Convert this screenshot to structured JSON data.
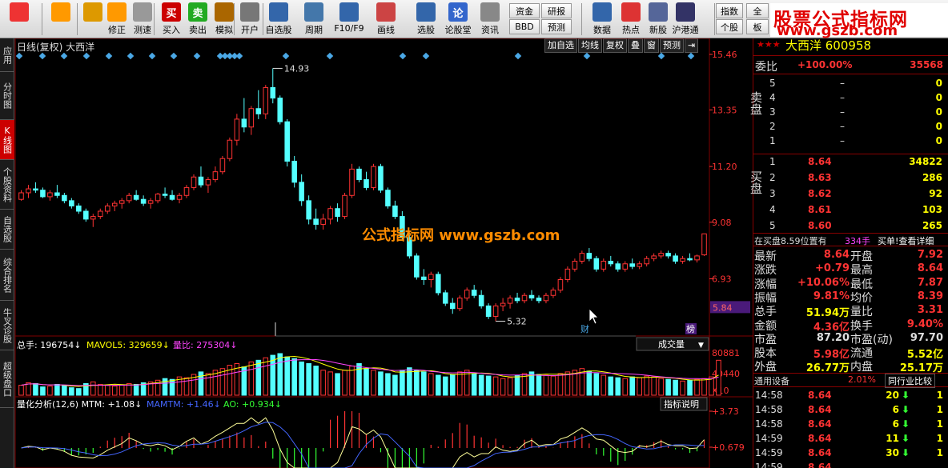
{
  "toolbar": {
    "buttons": [
      {
        "label": "",
        "icon": "grid-icon"
      },
      {
        "label": "",
        "icon": "back-arrow-icon"
      },
      {
        "label": "",
        "icon": "up-down-arrow-icon"
      },
      {
        "label": "修正",
        "icon": "correct-icon"
      },
      {
        "label": "测速",
        "icon": "clock-icon"
      },
      {
        "label": "买入",
        "icon": "buy-icon",
        "glyph": "买"
      },
      {
        "label": "卖出",
        "icon": "sell-icon",
        "glyph": "卖"
      },
      {
        "label": "模拟",
        "icon": "hammer-icon"
      },
      {
        "label": "开户",
        "icon": "lock-icon"
      },
      {
        "label": "自选股",
        "icon": "star-folder-icon"
      },
      {
        "label": "周期",
        "icon": "clock-cycle-icon"
      },
      {
        "label": "F10/F9",
        "icon": "f10-icon"
      },
      {
        "label": "画线",
        "icon": "pen-icon"
      },
      {
        "label": "选股",
        "icon": "select-stock-icon"
      },
      {
        "label": "论股堂",
        "icon": "forum-icon",
        "glyph": "论"
      },
      {
        "label": "资讯",
        "icon": "news-icon"
      },
      {
        "label": "数据",
        "icon": "data-icon"
      },
      {
        "label": "热点",
        "icon": "hot-icon"
      },
      {
        "label": "新股",
        "icon": "ipo-icon"
      },
      {
        "label": "沪港通",
        "icon": "hk-connect-icon"
      }
    ],
    "pills": [
      "资金",
      "BBD",
      "研报",
      "预测",
      "指数",
      "个股"
    ],
    "pill_partial": [
      "全",
      "板"
    ]
  },
  "logo": {
    "line1": "股票公式指标网",
    "line2": "www.gszb.com"
  },
  "sidebar": {
    "tabs": [
      "应用",
      "分时图",
      "K线图",
      "个股资料",
      "自选股",
      "综合排名",
      "牛叉诊股",
      "超级盘口"
    ],
    "active": 2
  },
  "chart": {
    "title": "日线(复权)  大西洋",
    "controls": [
      "加自选",
      "均线",
      "复权",
      "叠",
      "窗",
      "预测",
      "⇥"
    ],
    "price_axis": [
      "15.46",
      "13.35",
      "11.20",
      "9.08",
      "6.93"
    ],
    "current_price": "5.84",
    "max_label": "14.93",
    "min_label": "5.32",
    "watermark": "公式指标网  www.gszb.com",
    "markers": [
      "财",
      "榜"
    ],
    "candles": [
      [
        9.95,
        10.3,
        9.9,
        10.2
      ],
      [
        10.2,
        10.5,
        10.0,
        10.35
      ],
      [
        10.35,
        10.6,
        10.2,
        10.3
      ],
      [
        10.3,
        10.4,
        10.0,
        10.05
      ],
      [
        10.05,
        10.3,
        9.9,
        10.2
      ],
      [
        10.2,
        10.5,
        10.0,
        10.1
      ],
      [
        10.1,
        10.2,
        9.8,
        9.9
      ],
      [
        9.9,
        10.0,
        9.6,
        9.7
      ],
      [
        9.7,
        9.8,
        9.4,
        9.5
      ],
      [
        9.5,
        9.6,
        9.1,
        9.2
      ],
      [
        9.2,
        9.4,
        8.9,
        9.3
      ],
      [
        9.3,
        9.6,
        9.2,
        9.5
      ],
      [
        9.5,
        9.8,
        9.4,
        9.7
      ],
      [
        9.7,
        9.9,
        9.5,
        9.8
      ],
      [
        9.8,
        10.0,
        9.6,
        9.9
      ],
      [
        9.9,
        10.2,
        9.8,
        10.1
      ],
      [
        10.1,
        10.3,
        9.9,
        9.95
      ],
      [
        9.95,
        10.1,
        9.7,
        9.8
      ],
      [
        9.8,
        10.0,
        9.6,
        9.9
      ],
      [
        9.9,
        10.2,
        9.8,
        10.15
      ],
      [
        10.15,
        10.4,
        10.0,
        10.1
      ],
      [
        10.1,
        10.3,
        9.9,
        9.95
      ],
      [
        9.95,
        10.2,
        9.8,
        10.1
      ],
      [
        10.1,
        10.5,
        10.0,
        10.4
      ],
      [
        10.4,
        10.9,
        10.3,
        10.8
      ],
      [
        10.8,
        11.2,
        10.4,
        10.5
      ],
      [
        10.5,
        10.8,
        10.2,
        10.7
      ],
      [
        10.7,
        11.2,
        10.6,
        11.0
      ],
      [
        11.0,
        11.6,
        10.9,
        11.5
      ],
      [
        11.5,
        12.3,
        11.4,
        12.2
      ],
      [
        12.2,
        13.2,
        12.0,
        13.0
      ],
      [
        13.0,
        13.8,
        12.5,
        12.7
      ],
      [
        12.7,
        13.5,
        12.4,
        13.4
      ],
      [
        13.4,
        14.1,
        13.0,
        13.2
      ],
      [
        13.2,
        14.3,
        13.0,
        14.2
      ],
      [
        14.2,
        14.93,
        13.6,
        13.8
      ],
      [
        13.8,
        13.9,
        12.8,
        12.9
      ],
      [
        12.9,
        13.0,
        11.2,
        11.4
      ],
      [
        11.4,
        11.6,
        10.4,
        10.6
      ],
      [
        10.6,
        10.9,
        9.7,
        9.9
      ],
      [
        9.9,
        10.1,
        9.0,
        9.2
      ],
      [
        9.2,
        9.6,
        8.8,
        9.0
      ],
      [
        9.0,
        9.4,
        8.8,
        9.2
      ],
      [
        9.2,
        9.7,
        9.0,
        9.6
      ],
      [
        9.6,
        9.8,
        9.1,
        9.3
      ],
      [
        9.3,
        10.2,
        9.2,
        10.1
      ],
      [
        10.1,
        11.3,
        10.0,
        11.1
      ],
      [
        11.1,
        11.2,
        10.6,
        10.7
      ],
      [
        10.7,
        11.0,
        10.3,
        10.4
      ],
      [
        10.4,
        11.3,
        10.3,
        11.2
      ],
      [
        11.2,
        11.3,
        10.2,
        10.3
      ],
      [
        10.3,
        10.4,
        9.6,
        9.7
      ],
      [
        9.7,
        9.9,
        9.2,
        9.3
      ],
      [
        9.3,
        9.5,
        8.4,
        8.5
      ],
      [
        8.5,
        8.6,
        7.7,
        7.8
      ],
      [
        7.8,
        7.9,
        6.9,
        7.0
      ],
      [
        7.0,
        7.3,
        6.7,
        6.9
      ],
      [
        6.9,
        7.2,
        6.6,
        7.1
      ],
      [
        7.1,
        7.2,
        6.3,
        6.4
      ],
      [
        6.4,
        6.5,
        5.9,
        6.0
      ],
      [
        6.0,
        6.2,
        5.6,
        5.8
      ],
      [
        5.8,
        6.3,
        5.7,
        6.2
      ],
      [
        6.2,
        6.6,
        6.1,
        6.5
      ],
      [
        6.5,
        6.7,
        6.2,
        6.3
      ],
      [
        6.3,
        6.5,
        5.8,
        5.9
      ],
      [
        5.9,
        6.0,
        5.4,
        5.5
      ],
      [
        5.5,
        6.0,
        5.32,
        5.9
      ],
      [
        5.9,
        6.2,
        5.7,
        6.0
      ],
      [
        6.0,
        6.3,
        5.8,
        6.2
      ],
      [
        6.2,
        6.4,
        6.0,
        6.1
      ],
      [
        6.1,
        6.4,
        6.0,
        6.3
      ],
      [
        6.3,
        6.5,
        6.1,
        6.2
      ],
      [
        6.2,
        6.3,
        6.0,
        6.1
      ],
      [
        6.1,
        6.4,
        6.0,
        6.3
      ],
      [
        6.3,
        6.6,
        6.2,
        6.5
      ],
      [
        6.5,
        7.0,
        6.4,
        6.9
      ],
      [
        6.9,
        7.4,
        6.8,
        7.3
      ],
      [
        7.3,
        7.7,
        7.2,
        7.6
      ],
      [
        7.6,
        8.0,
        7.5,
        7.9
      ],
      [
        7.9,
        8.1,
        7.6,
        7.7
      ],
      [
        7.7,
        7.8,
        7.2,
        7.3
      ],
      [
        7.3,
        7.7,
        7.2,
        7.6
      ],
      [
        7.6,
        7.8,
        7.4,
        7.5
      ],
      [
        7.5,
        7.6,
        7.2,
        7.3
      ],
      [
        7.3,
        7.6,
        7.2,
        7.5
      ],
      [
        7.5,
        7.7,
        7.3,
        7.4
      ],
      [
        7.4,
        7.6,
        7.3,
        7.5
      ],
      [
        7.5,
        7.8,
        7.4,
        7.7
      ],
      [
        7.7,
        7.9,
        7.6,
        7.8
      ],
      [
        7.8,
        8.0,
        7.7,
        7.9
      ],
      [
        7.9,
        8.0,
        7.7,
        7.8
      ],
      [
        7.8,
        7.9,
        7.5,
        7.6
      ],
      [
        7.6,
        7.8,
        7.5,
        7.7
      ],
      [
        7.7,
        7.9,
        7.6,
        7.65
      ],
      [
        7.65,
        7.85,
        7.55,
        7.8
      ],
      [
        7.84,
        8.64,
        7.8,
        8.64
      ]
    ]
  },
  "volume": {
    "header_parts": [
      {
        "text": "总手: 196754",
        "color": "#ffffff"
      },
      {
        "text": "MAVOL5: 329659",
        "color": "#ffff00"
      },
      {
        "text": "量比: 275304",
        "color": "#ff44ff"
      }
    ],
    "dropdown": "成交量",
    "axis": [
      "80881",
      "40440",
      "X10"
    ],
    "vols": [
      12,
      15,
      14,
      10,
      11,
      13,
      12,
      9,
      8,
      14,
      16,
      13,
      12,
      11,
      12,
      14,
      13,
      15,
      16,
      18,
      20,
      19,
      22,
      21,
      25,
      28,
      26,
      30,
      32,
      36,
      38,
      34,
      40,
      42,
      45,
      48,
      50,
      46,
      44,
      40,
      38,
      35,
      30,
      28,
      26,
      30,
      35,
      38,
      32,
      30,
      28,
      26,
      24,
      30,
      33,
      30,
      28,
      26,
      24,
      22,
      25,
      28,
      30,
      26,
      24,
      23,
      22,
      20,
      21,
      24,
      26,
      28,
      25,
      24,
      23,
      26,
      28,
      30,
      32,
      29,
      26,
      24,
      22,
      21,
      20,
      22,
      21,
      23,
      22,
      20,
      19,
      18,
      17,
      18,
      19,
      20,
      22,
      42
    ]
  },
  "indicator": {
    "header_parts": [
      {
        "text": "量化分析(12,6) MTM: +1.08",
        "color": "#ffffff"
      },
      {
        "text": "MAMTM: +1.46",
        "color": "#4466ff"
      },
      {
        "text": "AO: +0.934",
        "color": "#33ff33"
      }
    ],
    "button": "指标说明",
    "axis": [
      "+3.73",
      "+0.679"
    ]
  },
  "quote": {
    "stock_name_partial": "大西洋 600958",
    "weibi_label": "委比",
    "weibi_val": "+100.00%",
    "weibi_count": "35568",
    "sell_label": "卖盘",
    "sells": [
      [
        "5",
        "–",
        "0"
      ],
      [
        "4",
        "–",
        "0"
      ],
      [
        "3",
        "–",
        "0"
      ],
      [
        "2",
        "–",
        "0"
      ],
      [
        "1",
        "–",
        "0"
      ]
    ],
    "buy_label": "买盘",
    "buys": [
      [
        "1",
        "8.64",
        "34822"
      ],
      [
        "2",
        "8.63",
        "286"
      ],
      [
        "3",
        "8.62",
        "92"
      ],
      [
        "4",
        "8.61",
        "103"
      ],
      [
        "5",
        "8.60",
        "265"
      ]
    ],
    "info_line": "在买盘8.59位置有",
    "info_hands": "334手",
    "info_link": "买单!查看详细",
    "stats": [
      [
        "最新",
        "8.64",
        "开盘",
        "7.92"
      ],
      [
        "涨跌",
        "+0.79",
        "最高",
        "8.64"
      ],
      [
        "涨幅",
        "+10.06%",
        "最低",
        "7.87"
      ],
      [
        "振幅",
        "9.81%",
        "均价",
        "8.39"
      ],
      [
        "总手",
        "51.94万",
        "量比",
        "3.31"
      ],
      [
        "金额",
        "4.36亿",
        "换手",
        "9.40%"
      ],
      [
        "市盈",
        "87.20",
        "市盈(动)",
        "97.70"
      ],
      [
        "股本",
        "5.98亿",
        "流通",
        "5.52亿"
      ],
      [
        "外盘",
        "26.77万",
        "内盘",
        "25.17万"
      ]
    ],
    "industry_label": "通用设备",
    "industry_pct": "2.01%",
    "compare_button": "同行业比较",
    "ticks": [
      [
        "14:58",
        "8.64",
        "20",
        "1"
      ],
      [
        "14:58",
        "8.64",
        "6",
        "1"
      ],
      [
        "14:58",
        "8.64",
        "6",
        "1"
      ],
      [
        "14:59",
        "8.64",
        "11",
        "1"
      ],
      [
        "14:59",
        "8.64",
        "30",
        "1"
      ],
      [
        "14:59",
        "8.64",
        "",
        ""
      ]
    ]
  },
  "colors": {
    "up": "#ff3333",
    "down": "#54ffff",
    "axis": "#ff3333",
    "text": "#dddddd",
    "gold": "#ffff00"
  }
}
